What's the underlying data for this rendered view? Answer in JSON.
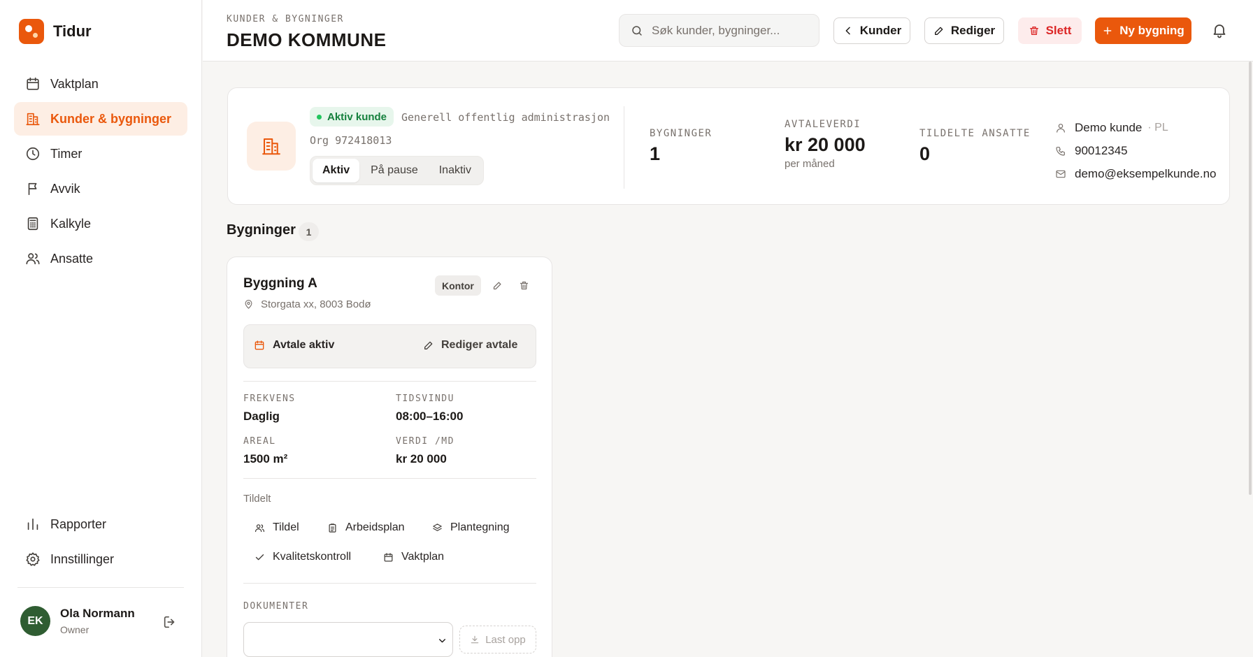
{
  "app": {
    "name": "Tidur"
  },
  "sidebar": {
    "items": [
      {
        "label": "Vaktplan",
        "icon": "calendar-icon"
      },
      {
        "label": "Kunder & bygninger",
        "icon": "building-icon",
        "active": true
      },
      {
        "label": "Timer",
        "icon": "clock-icon"
      },
      {
        "label": "Avvik",
        "icon": "flag-icon"
      },
      {
        "label": "Kalkyle",
        "icon": "calculator-icon"
      },
      {
        "label": "Ansatte",
        "icon": "users-icon"
      }
    ],
    "bottom_items": [
      {
        "label": "Rapporter",
        "icon": "bar-chart-icon"
      },
      {
        "label": "Innstillinger",
        "icon": "gear-icon"
      }
    ],
    "user": {
      "initials": "EK",
      "name": "Ola Normann",
      "role": "Owner"
    }
  },
  "header": {
    "breadcrumb": "KUNDER & BYGNINGER",
    "title": "DEMO KOMMUNE",
    "search_placeholder": "Søk kunder, bygninger...",
    "back_label": "Kunder",
    "edit_label": "Rediger",
    "delete_label": "Slett",
    "new_label": "Ny bygning"
  },
  "customer": {
    "status_badge": "Aktiv kunde",
    "industry": "Generell offentlig administrasjon",
    "org": "Org 972418013",
    "status_options": [
      "Aktiv",
      "På pause",
      "Inaktiv"
    ],
    "selected_status": "Aktiv",
    "stats": {
      "buildings_label": "BYGNINGER",
      "buildings_value": "1",
      "contract_label": "AVTALEVERDI",
      "contract_value": "kr 20 000",
      "contract_sub": "per måned",
      "employees_label": "TILDELTE ANSATTE",
      "employees_value": "0"
    },
    "contact": {
      "name": "Demo kunde",
      "role": "· PL",
      "phone": "90012345",
      "email": "demo@eksempelkunde.no"
    }
  },
  "buildings": {
    "title": "Bygninger",
    "count": "1",
    "items": [
      {
        "name": "Byggning A",
        "address": "Storgata xx, 8003 Bodø",
        "type": "Kontor",
        "agreement_status": "Avtale aktiv",
        "edit_agreement": "Rediger avtale",
        "frequency_label": "FREKVENS",
        "frequency": "Daglig",
        "window_label": "TIDSVINDU",
        "window": "08:00–16:00",
        "area_label": "AREAL",
        "area": "1500 m²",
        "value_label": "VERDI /MD",
        "value": "kr 20 000",
        "assigned_label": "Tildelt",
        "actions": [
          "Tildel",
          "Arbeidsplan",
          "Plantegning",
          "Kvalitetskontroll",
          "Vaktplan"
        ],
        "documents_label": "DOKUMENTER",
        "upload_label": "Last opp"
      }
    ]
  },
  "colors": {
    "accent": "#ea580c",
    "accent_soft": "#fdeee4",
    "success": "#15803d",
    "danger": "#dc2626",
    "avatar": "#2f5d32"
  }
}
